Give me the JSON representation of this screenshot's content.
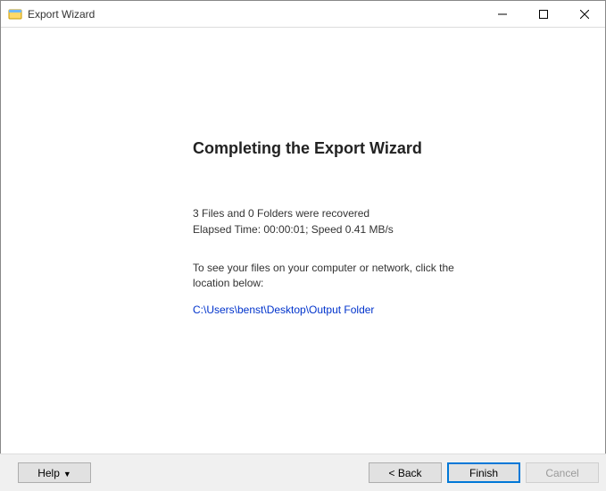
{
  "window": {
    "title": "Export Wizard"
  },
  "page": {
    "heading": "Completing the Export Wizard",
    "summary1": "3 Files and 0 Folders were recovered",
    "summary2": "Elapsed Time: 00:00:01; Speed 0.41 MB/s",
    "hint": "To see your files on your computer or network, click the location below:",
    "output_path": "C:\\Users\\benst\\Desktop\\Output Folder"
  },
  "footer": {
    "help_label": "Help",
    "back_label": "< Back",
    "finish_label": "Finish",
    "cancel_label": "Cancel"
  }
}
